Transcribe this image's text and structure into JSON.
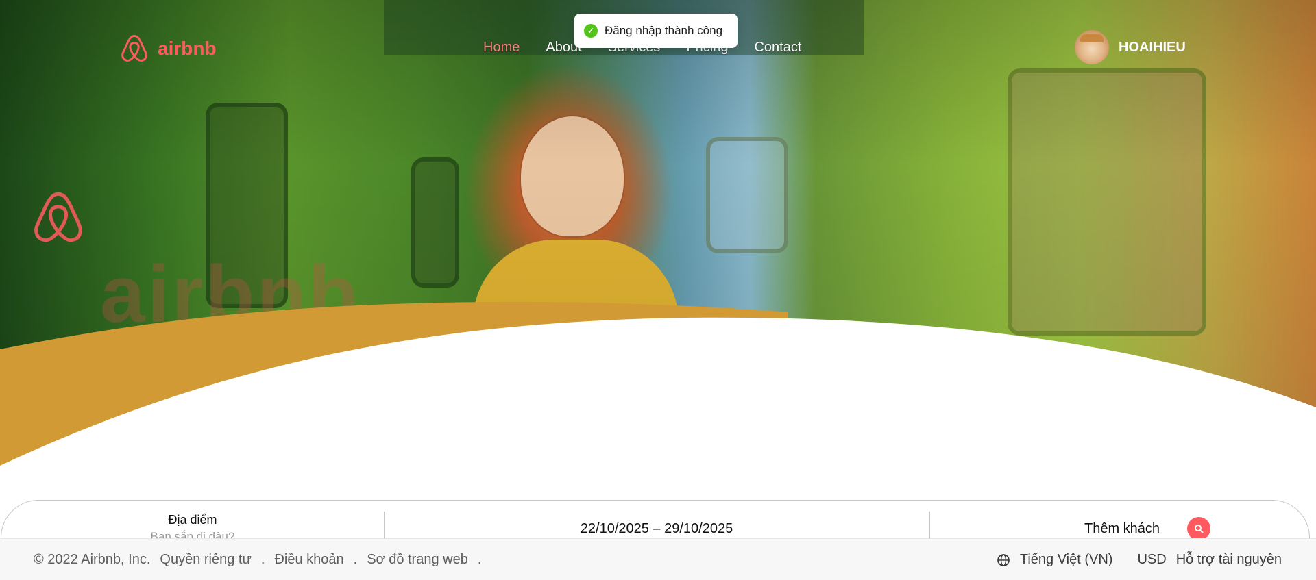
{
  "brand": {
    "name": "airbnb",
    "watermark": "airbnb",
    "color": "#ff5a5f"
  },
  "nav": {
    "items": [
      {
        "label": "Home",
        "active": true
      },
      {
        "label": "About",
        "active": false
      },
      {
        "label": "Services",
        "active": false
      },
      {
        "label": "Pricing",
        "active": false
      },
      {
        "label": "Contact",
        "active": false
      }
    ]
  },
  "user": {
    "name": "HOAIHIEU",
    "avatar_icon": "cat-avatar"
  },
  "toast": {
    "message": "Đăng nhập thành công",
    "icon": "check-circle-icon",
    "color": "#52c41a"
  },
  "search": {
    "location_label": "Địa điểm",
    "location_placeholder": "Bạn sắp đi đâu?",
    "date_range": "22/10/2025 – 29/10/2025",
    "guests_label": "Thêm khách",
    "search_icon": "search-icon"
  },
  "footer": {
    "copyright": "© 2022 Airbnb, Inc.",
    "links": [
      "Quyền riêng tư",
      "Điều khoản",
      "Sơ đồ trang web"
    ],
    "separator": ".",
    "language": "Tiếng Việt (VN)",
    "currency": "USD",
    "support": "Hỗ trợ tài nguyên"
  },
  "colors": {
    "accent": "#ff5a5f",
    "wave": "#d19a35",
    "hero_bg": "#5e9c2d"
  }
}
